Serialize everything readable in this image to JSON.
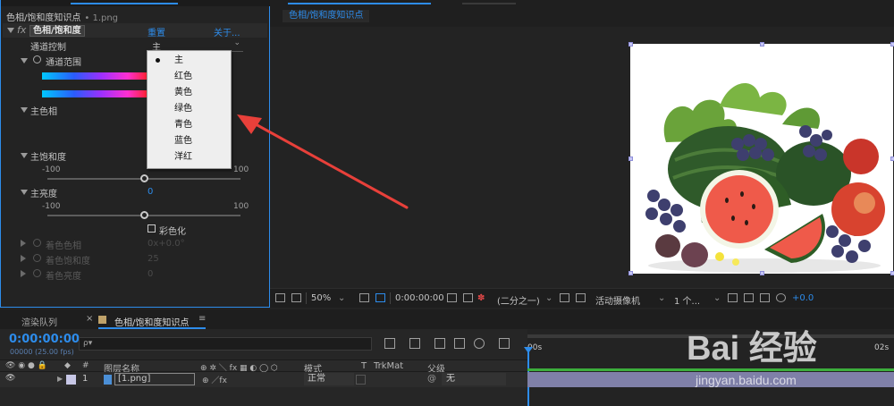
{
  "effect_controls": {
    "tab_partial_1": "…",
    "file_label": "色相/饱和度知识点",
    "file_sub": "• 1.png",
    "effect_name": "色相/饱和度",
    "reset_label": "重置",
    "about_label": "关于...",
    "channel_control_label": "通道控制",
    "channel_control_value": "主",
    "channel_range_label": "通道范围",
    "master_hue_label": "主色相",
    "master_saturation_label": "主饱和度",
    "saturation_min": "-100",
    "saturation_max": "100",
    "master_lightness_label": "主亮度",
    "lightness_value": "0",
    "lightness_min": "-100",
    "lightness_max": "100",
    "colorize_label": "彩色化",
    "colorize_hue_label": "着色色相",
    "colorize_hue_value": "0x+0.0°",
    "colorize_saturation_label": "着色饱和度",
    "colorize_saturation_value": "25",
    "colorize_lightness_label": "着色亮度",
    "colorize_lightness_value": "0"
  },
  "channel_dropdown": {
    "selected": "主",
    "options": [
      "主",
      "红色",
      "黄色",
      "绿色",
      "青色",
      "蓝色",
      "洋红"
    ]
  },
  "viewer": {
    "comp_tab_label": "色相/饱和度知识点",
    "zoom": "50%",
    "timecode": "0:00:00:00",
    "resolution": "(二分之一)",
    "camera": "活动摄像机",
    "views": "1 个...",
    "exposure": "+0.0"
  },
  "timeline": {
    "render_queue_tab": "渲染队列",
    "comp_tab": "色相/饱和度知识点",
    "timecode": "0:00:00:00",
    "fps": "00000 (25.00 fps)",
    "search_placeholder": "ρ▾",
    "col_layer_name": "图层名称",
    "col_mode": "模式",
    "col_t": "T",
    "col_trkmat": "TrkMat",
    "col_parent": "父级",
    "layer_index": "1",
    "layer_name": "[1.png]",
    "layer_mode": "正常",
    "layer_parent": "无",
    "ruler_start": "00s",
    "ruler_end": "02s"
  },
  "watermark": {
    "brand": "Bai 经验",
    "url": "jingyan.baidu.com"
  },
  "colors": {
    "accent": "#2d8ceb",
    "panel_bg": "#232323",
    "arrow": "#e8403a"
  }
}
